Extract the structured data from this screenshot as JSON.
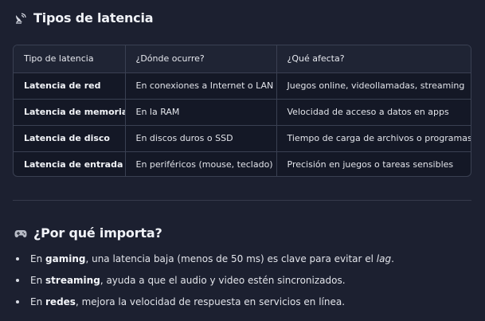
{
  "section1": {
    "icon": "satellite-dish-icon",
    "title": "Tipos de latencia"
  },
  "table": {
    "headers": [
      "Tipo de latencia",
      "¿Dónde ocurre?",
      "¿Qué afecta?"
    ],
    "rows": [
      [
        "Latencia de red",
        "En conexiones a Internet o LAN",
        "Juegos online, videollamadas, streaming"
      ],
      [
        "Latencia de memoria",
        "En la RAM",
        "Velocidad de acceso a datos en apps"
      ],
      [
        "Latencia de disco",
        "En discos duros o SSD",
        "Tiempo de carga de archivos o programas"
      ],
      [
        "Latencia de entrada",
        "En periféricos (mouse, teclado)",
        "Precisión en juegos o tareas sensibles"
      ]
    ]
  },
  "section2": {
    "icon": "game-controller-icon",
    "title": "¿Por qué importa?"
  },
  "bullets": [
    {
      "pre": "En ",
      "bold": "gaming",
      "post": ", una latencia baja (menos de 50 ms) es clave para evitar el ",
      "italic": "lag",
      "end": "."
    },
    {
      "pre": "En ",
      "bold": "streaming",
      "post": ", ayuda a que el audio y video estén sincronizados.",
      "italic": "",
      "end": ""
    },
    {
      "pre": "En ",
      "bold": "redes",
      "post": ", mejora la velocidad de respuesta en servicios en línea.",
      "italic": "",
      "end": ""
    }
  ],
  "colors": {
    "background": "#1c2030",
    "table_bg": "#141826",
    "border": "#3a4052"
  }
}
